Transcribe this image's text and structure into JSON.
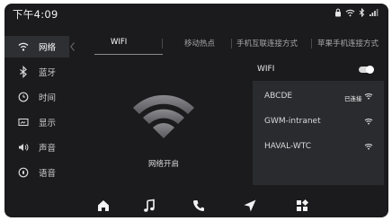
{
  "status_bar": {
    "time": "下午4:09",
    "icons": [
      "lock-icon",
      "wifi-icon",
      "bluetooth-icon",
      "signal-icon"
    ]
  },
  "sidebar": {
    "items": [
      {
        "label": "网络",
        "icon": "wifi-icon",
        "active": true
      },
      {
        "label": "蓝牙",
        "icon": "bluetooth-icon",
        "active": false
      },
      {
        "label": "时间",
        "icon": "clock-icon",
        "active": false
      },
      {
        "label": "显示",
        "icon": "display-icon",
        "active": false
      },
      {
        "label": "声音",
        "icon": "speaker-icon",
        "active": false
      },
      {
        "label": "语音",
        "icon": "voice-icon",
        "active": false
      }
    ]
  },
  "tabs": [
    {
      "label": "WIFI",
      "active": true
    },
    {
      "label": "移动热点",
      "active": false
    },
    {
      "label": "手机互联连接方式",
      "active": false
    },
    {
      "label": "苹果手机连接方式",
      "active": false
    }
  ],
  "center": {
    "status_text": "网络开启"
  },
  "wifi_panel": {
    "title": "WIFI",
    "enabled": true,
    "networks": [
      {
        "name": "ABCDE",
        "state": "已连接"
      },
      {
        "name": "GWM-intranet",
        "state": ""
      },
      {
        "name": "HAVAL-WTC",
        "state": ""
      }
    ]
  },
  "dock": {
    "items": [
      "home-icon",
      "music-icon",
      "phone-icon",
      "navigation-icon",
      "apps-icon"
    ]
  },
  "colors": {
    "background": "#1b1b1d",
    "sidebar_active": "#2e2f33",
    "list_panel": "#2a2b2f",
    "text": "#dcdcdc"
  }
}
